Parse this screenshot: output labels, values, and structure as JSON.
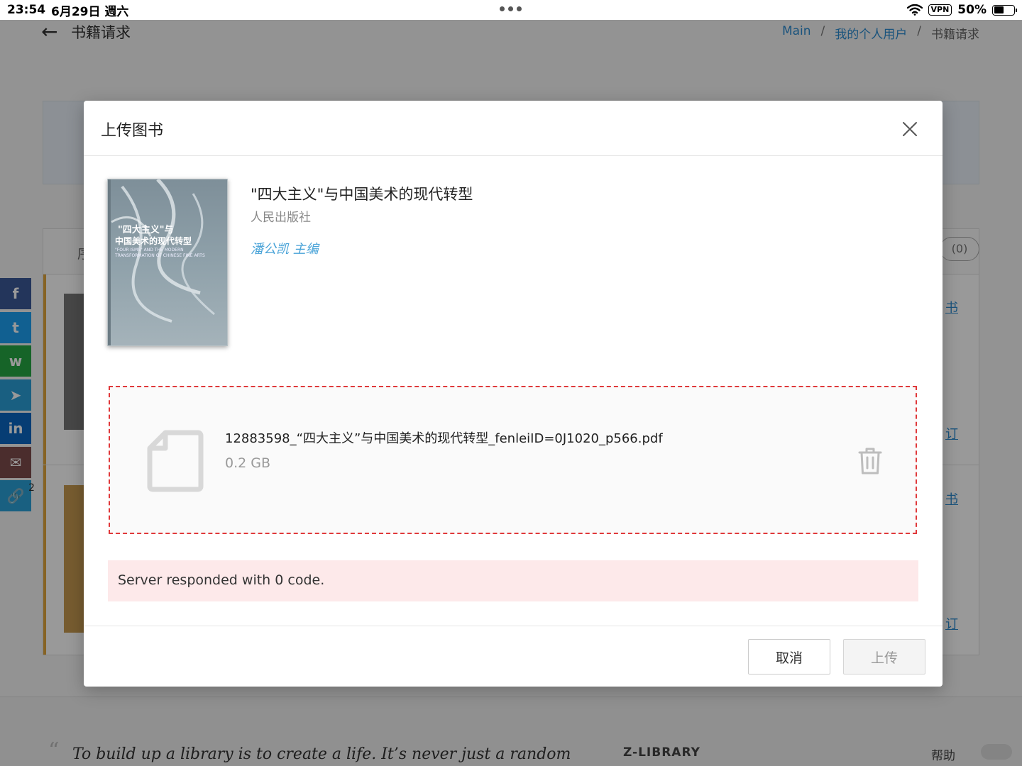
{
  "status_bar": {
    "time": "23:54",
    "date": "6月29日 週六",
    "vpn": "VPN",
    "battery": "50%",
    "battery_level": 0.5
  },
  "page": {
    "heading": "书籍请求",
    "breadcrumb": [
      {
        "label": "Main",
        "link": true
      },
      {
        "label": "我的个人用户",
        "link": true
      },
      {
        "label": "书籍请求",
        "link": false
      }
    ],
    "tab_fragment": "序",
    "pill_count": "(0)",
    "side_links": [
      "书",
      "订",
      "书",
      "订"
    ],
    "share_number": "2"
  },
  "share_buttons": [
    {
      "name": "facebook",
      "glyph": "f",
      "color": "#3b5998"
    },
    {
      "name": "twitter",
      "glyph": "t",
      "color": "#1da1f2"
    },
    {
      "name": "whatsapp",
      "glyph": "w",
      "color": "#25a744"
    },
    {
      "name": "telegram",
      "glyph": "➤",
      "color": "#2a9ed8"
    },
    {
      "name": "linkedin",
      "glyph": "in",
      "color": "#0a66c2"
    },
    {
      "name": "email",
      "glyph": "✉",
      "color": "#7e4b4b"
    },
    {
      "name": "copy-link",
      "glyph": "🔗",
      "color": "#2aa0d8"
    }
  ],
  "footer": {
    "quote": "To build up a library is to create a life. It’s never just a random",
    "brand": "Z-LIBRARY",
    "help": "帮助"
  },
  "modal": {
    "title": "上传图书",
    "book": {
      "title": "\"四大主义\"与中国美术的现代转型",
      "publisher": "人民出版社",
      "author": "潘公凯 主编",
      "cover_text_main": "\"四大主义\"与",
      "cover_text_sub": "中国美术的现代转型",
      "cover_text_en": "\"FOUR ISMS\" AND THE MODERN TRANSFORMATION OF CHINESE FINE ARTS"
    },
    "file": {
      "name": "12883598_“四大主义”与中国美术的现代转型_fenleiID=0J1020_p566.pdf",
      "size": "0.2 GB"
    },
    "error": "Server responded with 0 code.",
    "cancel_label": "取消",
    "upload_label": "上传"
  },
  "colors": {
    "accent_blue": "#2b8bd0",
    "author_blue": "#49a3d8",
    "dropzone_border": "#e0393b",
    "error_bg": "#fde9ea"
  }
}
